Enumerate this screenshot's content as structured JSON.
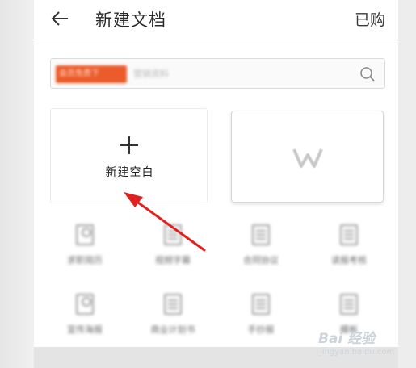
{
  "header": {
    "title": "新建文档",
    "purchased_label": "已购",
    "back_icon": "arrow-left-icon"
  },
  "search": {
    "tag_label": "会员免费下",
    "placeholder": "营销资料",
    "icon": "search-icon"
  },
  "cards": {
    "new_blank_label": "新建空白",
    "new_blank_icon": "plus-icon",
    "template_logo": "wps-logo-icon"
  },
  "templates": [
    {
      "label": "求职简历",
      "icon": "person-doc-icon"
    },
    {
      "label": "视频字幕",
      "icon": "grid-doc-icon"
    },
    {
      "label": "合同协议",
      "icon": "contract-doc-icon"
    },
    {
      "label": "读报考核",
      "icon": "chart-doc-icon"
    },
    {
      "label": "宣传海报",
      "icon": "poster-doc-icon"
    },
    {
      "label": "商业计划书",
      "icon": "plan-doc-icon"
    },
    {
      "label": "手抄报",
      "icon": "handout-doc-icon"
    },
    {
      "label": "模板",
      "icon": "template-doc-icon"
    }
  ],
  "watermark": {
    "brand": "Bai 经验",
    "url": "jingyan.baidu.com"
  },
  "colors": {
    "tag_orange": "#ec5b2a",
    "arrow_red": "#e02020"
  }
}
